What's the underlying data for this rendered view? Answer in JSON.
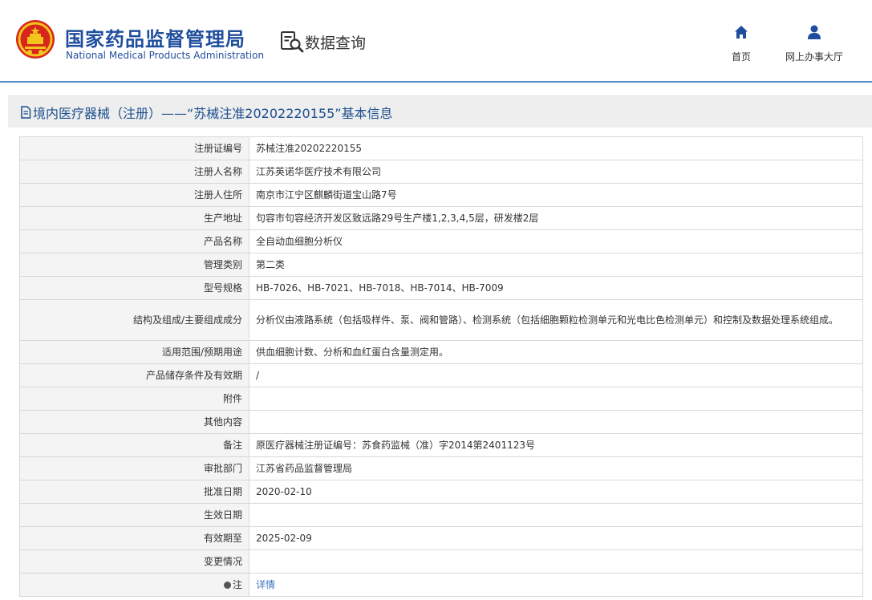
{
  "header": {
    "org_name_cn": "国家药品监督管理局",
    "org_name_en": "National Medical Products Administration",
    "query_label": "数据查询",
    "nav": [
      {
        "label": "首页",
        "icon": "home-icon"
      },
      {
        "label": "网上办事大厅",
        "icon": "user-icon"
      }
    ],
    "colors": {
      "brand": "#1f4e9e",
      "accent_line": "#5a8fc5",
      "emblem_red": "#d7261c",
      "emblem_gold": "#f3c41c"
    }
  },
  "page": {
    "title": "境内医疗器械（注册）——“苏械注准20202220155”基本信息"
  },
  "details": {
    "rows": [
      {
        "label": "注册证编号",
        "value": "苏械注准20202220155"
      },
      {
        "label": "注册人名称",
        "value": "江苏英诺华医疗技术有限公司"
      },
      {
        "label": "注册人住所",
        "value": "南京市江宁区麒麟街道宝山路7号"
      },
      {
        "label": "生产地址",
        "value": "句容市句容经济开发区致远路29号生产楼1,2,3,4,5层，研发楼2层"
      },
      {
        "label": "产品名称",
        "value": "全自动血细胞分析仪"
      },
      {
        "label": "管理类别",
        "value": "第二类"
      },
      {
        "label": "型号规格",
        "value": "HB-7026、HB-7021、HB-7018、HB-7014、HB-7009"
      },
      {
        "label": "结构及组成/主要组成成分",
        "value": "分析仪由液路系统（包括吸样件、泵、阀和管路）、检测系统（包括细胞颗粒检测单元和光电比色检测单元）和控制及数据处理系统组成。"
      },
      {
        "label": "适用范围/预期用途",
        "value": "供血细胞计数、分析和血红蛋白含量测定用。"
      },
      {
        "label": "产品储存条件及有效期",
        "value": "/"
      },
      {
        "label": "附件",
        "value": ""
      },
      {
        "label": "其他内容",
        "value": ""
      },
      {
        "label": "备注",
        "value": "原医疗器械注册证编号：苏食药监械（准）字2014第2401123号"
      },
      {
        "label": "审批部门",
        "value": "江苏省药品监督管理局"
      },
      {
        "label": "批准日期",
        "value": "2020-02-10"
      },
      {
        "label": "生效日期",
        "value": ""
      },
      {
        "label": "有效期至",
        "value": "2025-02-09"
      },
      {
        "label": "变更情况",
        "value": ""
      },
      {
        "label": "注",
        "value": "详情"
      }
    ]
  }
}
